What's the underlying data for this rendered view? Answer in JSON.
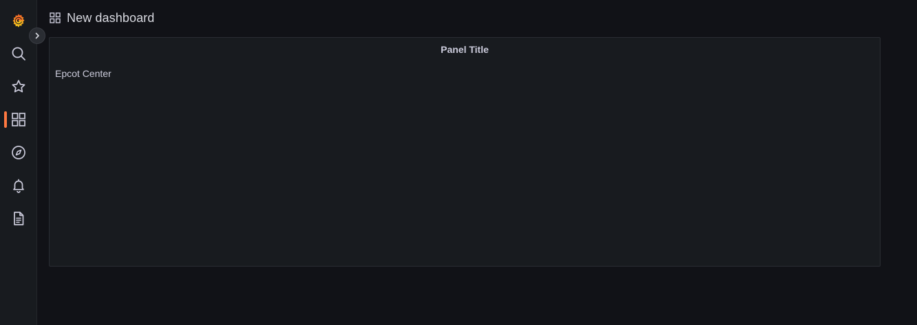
{
  "header": {
    "title": "New dashboard"
  },
  "sidebar": {
    "items": [
      {
        "icon": "grafana-logo-icon"
      },
      {
        "icon": "search-icon"
      },
      {
        "icon": "star-icon"
      },
      {
        "icon": "dashboards-icon",
        "active": true
      },
      {
        "icon": "compass-icon"
      },
      {
        "icon": "bell-icon"
      },
      {
        "icon": "document-icon"
      }
    ],
    "accent_color": "#ff7941"
  },
  "panel": {
    "title": "Panel Title",
    "text": "Epcot Center"
  }
}
